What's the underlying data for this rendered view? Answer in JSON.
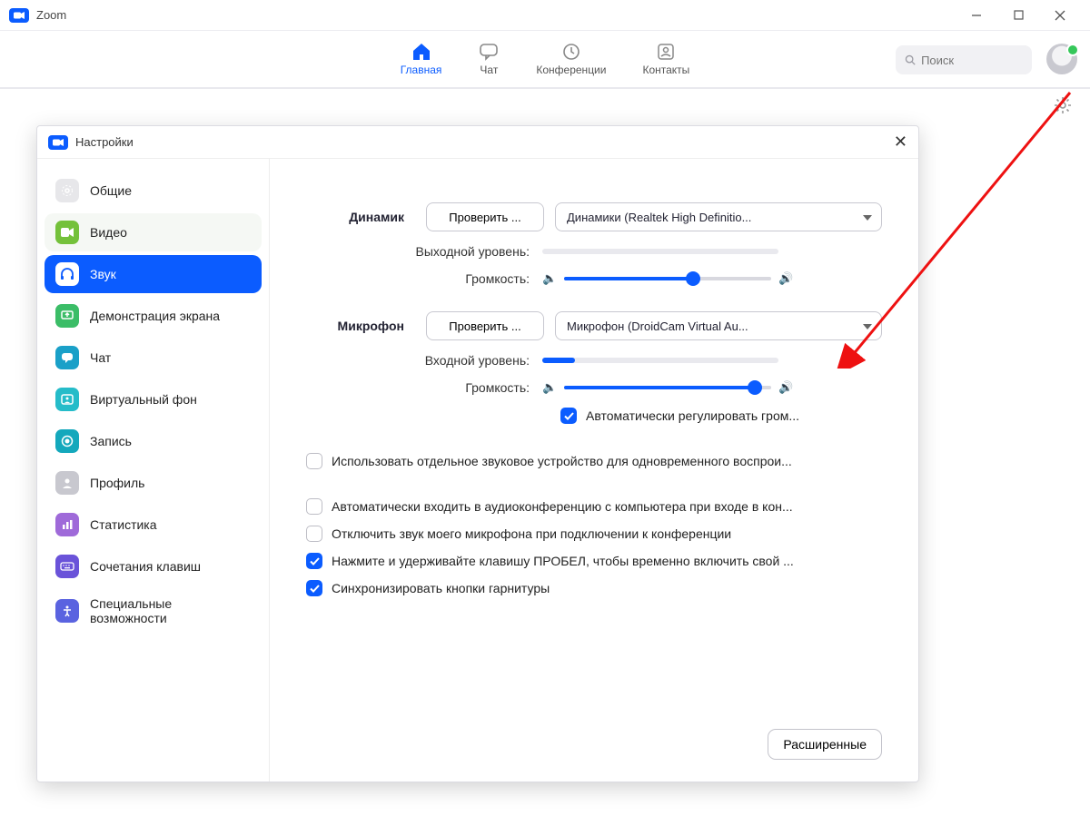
{
  "app": {
    "title": "Zoom"
  },
  "nav": {
    "home": "Главная",
    "chat": "Чат",
    "meetings": "Конференции",
    "contacts": "Контакты",
    "search_placeholder": "Поиск"
  },
  "dialog": {
    "title": "Настройки",
    "close_glyph": "✕"
  },
  "sidenav": {
    "general": "Общие",
    "video": "Видео",
    "audio": "Звук",
    "share": "Демонстрация экрана",
    "chat": "Чат",
    "vbg": "Виртуальный фон",
    "rec": "Запись",
    "profile": "Профиль",
    "stats": "Статистика",
    "keys": "Сочетания клавиш",
    "acc": "Специальные возможности"
  },
  "audio": {
    "speaker_title": "Динамик",
    "test_speaker": "Проверить ...",
    "speaker_device": "Динамики (Realtek High Definitio...",
    "output_level": "Выходной уровень:",
    "volume": "Громкость:",
    "speaker_volume_pct": 62,
    "mic_title": "Микрофон",
    "test_mic": "Проверить ...",
    "mic_device": "Микрофон (DroidCam Virtual Au...",
    "input_level": "Входной уровень:",
    "input_level_pct": 14,
    "mic_volume_pct": 92,
    "auto_volume": "Автоматически регулировать гром...",
    "sep_device": "Использовать отдельное звуковое устройство для одновременного воспрои...",
    "auto_join": "Автоматически входить в аудиоконференцию с компьютера при входе в кон...",
    "mute_on_join": "Отключить звук моего микрофона при подключении к конференции",
    "ptt": "Нажмите и удерживайте клавишу ПРОБЕЛ, чтобы временно включить свой ...",
    "sync_headset": "Синхронизировать кнопки гарнитуры",
    "advanced": "Расширенные"
  }
}
